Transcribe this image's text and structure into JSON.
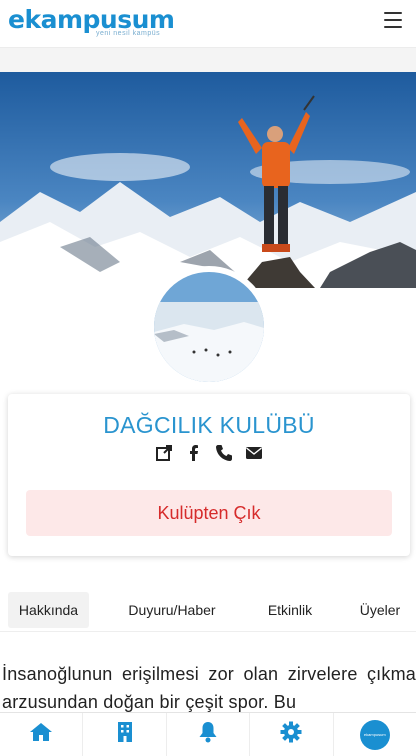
{
  "header": {
    "logo_text": "ekampusum",
    "logo_tagline": "yeni nesil kampüs",
    "menu_icon": "hamburger-icon"
  },
  "club": {
    "title": "DAĞCILIK KULÜBÜ",
    "social_icons": [
      "external-link-icon",
      "facebook-icon",
      "phone-icon",
      "envelope-icon"
    ],
    "leave_label": "Kulüpten Çık"
  },
  "tabs": [
    {
      "label": "Hakkında",
      "active": true
    },
    {
      "label": "Duyuru/Haber",
      "active": false
    },
    {
      "label": "Etkinlik",
      "active": false
    },
    {
      "label": "Üyeler",
      "active": false
    }
  ],
  "about": {
    "text": "İnsanoğlunun erişilmesi zor olan zirvelere çıkma arzusundan doğan bir çeşit spor. Bu"
  },
  "bottom_nav": {
    "items": [
      "home-icon",
      "building-icon",
      "bell-icon",
      "gear-icon",
      "profile-avatar"
    ],
    "avatar_text": "ekampusum"
  },
  "colors": {
    "brand": "#1a8fd1",
    "title": "#2a94cf",
    "danger": "#d62b2b",
    "danger_bg": "#fde8e8"
  }
}
